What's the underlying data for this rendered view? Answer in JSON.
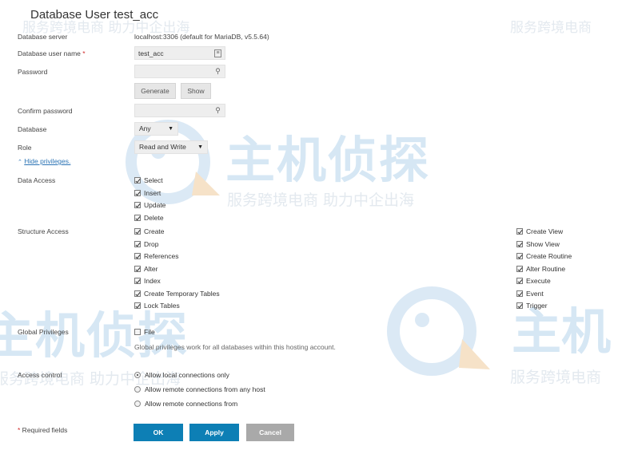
{
  "title": "Database User test_acc",
  "watermark": {
    "line_small": "服务跨境电商 助力中企出海",
    "line_right": "服务跨境电商",
    "big": "主机侦探",
    "big_partial": "主机"
  },
  "form": {
    "server_label": "Database server",
    "server_value": "localhost:3306 (default for MariaDB, v5.5.64)",
    "username_label": "Database user name",
    "required_mark": "*",
    "username_value": "test_acc",
    "password_label": "Password",
    "password_value": "",
    "generate_label": "Generate",
    "show_label": "Show",
    "confirm_label": "Confirm password",
    "confirm_value": "",
    "database_label": "Database",
    "database_value": "Any",
    "role_label": "Role",
    "role_value": "Read and Write",
    "hide_privileges": "Hide privileges."
  },
  "privileges": {
    "data_access_label": "Data Access",
    "data_access": [
      "Select",
      "Insert",
      "Update",
      "Delete"
    ],
    "structure_label": "Structure Access",
    "structure_left": [
      "Create",
      "Drop",
      "References",
      "Alter",
      "Index",
      "Create Temporary Tables",
      "Lock Tables"
    ],
    "structure_right": [
      "Create View",
      "Show View",
      "Create Routine",
      "Alter Routine",
      "Execute",
      "Event",
      "Trigger"
    ],
    "global_label": "Global Privileges",
    "global_item": "File",
    "global_note": "Global privileges work for all databases within this hosting account."
  },
  "access": {
    "label": "Access control",
    "options": [
      "Allow local connections only",
      "Allow remote connections from any host",
      "Allow remote connections from"
    ],
    "selected": 0
  },
  "footer": {
    "required_note": "* Required fields",
    "ok_label": "OK",
    "apply_label": "Apply",
    "cancel_label": "Cancel"
  },
  "colors": {
    "primary_button": "#0d7fb5",
    "cancel_button": "#a9a9a9",
    "link": "#2c74b5",
    "required": "#d02b2b"
  },
  "icons": {
    "username_field": "card-icon",
    "password_field": "key-icon",
    "confirm_field": "key-icon",
    "hide_privileges": "chevron-up-icon"
  }
}
